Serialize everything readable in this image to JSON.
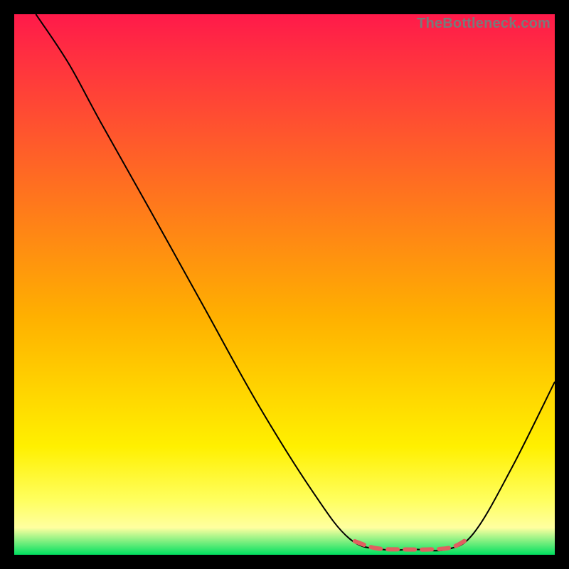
{
  "watermark": "TheBottleneck.com",
  "chart_data": {
    "type": "line",
    "title": "",
    "xlabel": "",
    "ylabel": "",
    "x_range": [
      0,
      100
    ],
    "y_range": [
      0,
      100
    ],
    "series": [
      {
        "name": "bottleneck-curve",
        "points": [
          {
            "x": 4,
            "y": 100
          },
          {
            "x": 10,
            "y": 91
          },
          {
            "x": 16,
            "y": 80
          },
          {
            "x": 25,
            "y": 64
          },
          {
            "x": 35,
            "y": 46
          },
          {
            "x": 45,
            "y": 28
          },
          {
            "x": 55,
            "y": 12
          },
          {
            "x": 62,
            "y": 3
          },
          {
            "x": 68,
            "y": 1
          },
          {
            "x": 74,
            "y": 1
          },
          {
            "x": 80,
            "y": 1
          },
          {
            "x": 85,
            "y": 4
          },
          {
            "x": 92,
            "y": 16
          },
          {
            "x": 100,
            "y": 32
          }
        ]
      },
      {
        "name": "optimal-zone",
        "points": [
          {
            "x": 63,
            "y": 2.5
          },
          {
            "x": 67,
            "y": 1.2
          },
          {
            "x": 72,
            "y": 1
          },
          {
            "x": 77,
            "y": 1
          },
          {
            "x": 81,
            "y": 1.4
          },
          {
            "x": 84,
            "y": 3
          }
        ]
      }
    ],
    "background_gradient": {
      "top": "#ff1a4a",
      "bottom": "#00e060"
    }
  }
}
